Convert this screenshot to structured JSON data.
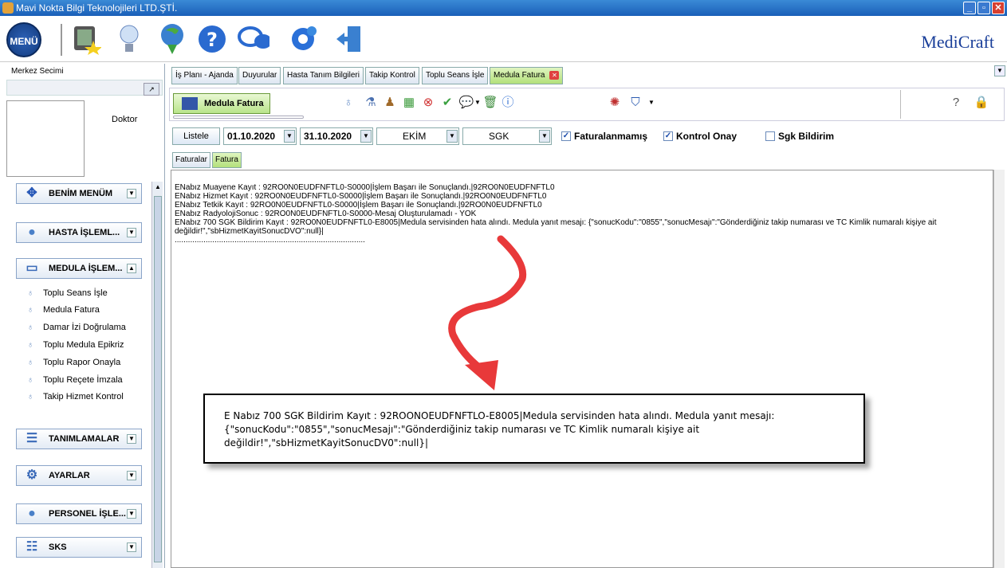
{
  "window": {
    "title": "Mavi Nokta Bilgi Teknolojileri LTD.ŞTİ.",
    "min": "_",
    "restore": "▫",
    "close": "✕"
  },
  "toolbar": {
    "menu_label": "MENÜ",
    "brand": "MediCraft",
    "icons": [
      "book-star-icon",
      "lightbulb-icon",
      "internet-download-icon",
      "help-icon",
      "chat-icon",
      "settings-gear-icon",
      "exit-door-icon"
    ]
  },
  "left": {
    "merkez_label": "Merkez Secimi",
    "doktor_label": "Doktor",
    "groups": [
      {
        "label": "BENİM MENÜM"
      },
      {
        "label": "HASTA İŞLEML..."
      },
      {
        "label": "MEDULA İŞLEM..."
      },
      {
        "label": "TANIMLAMALAR"
      },
      {
        "label": "AYARLAR"
      },
      {
        "label": "PERSONEL İŞLE..."
      },
      {
        "label": "SKS"
      }
    ],
    "medula_items": [
      "Toplu Seans İşle",
      "Medula Fatura",
      "Damar İzi Doğrulama",
      "Toplu Medula Epikriz",
      "Toplu Rapor Onayla",
      "Toplu Reçete İmzala",
      "Takip Hizmet Kontrol"
    ]
  },
  "tabs": [
    "İş Planı - Ajanda",
    "Duyurular",
    "Hasta Tanım Bilgileri",
    "Takip Kontrol",
    "Toplu Seans İşle",
    "Medula Fatura"
  ],
  "subtoolbar": {
    "medula_fatura_button": "Medula Fatura"
  },
  "filters": {
    "listele": "Listele",
    "date_start": "01.10.2020",
    "date_end": "31.10.2020",
    "month": "EKİM",
    "institution": "SGK",
    "faturalanmamis": "Faturalanmamış",
    "kontrol_onay": "Kontrol Onay",
    "sgk_bildirim": "Sgk Bildirim"
  },
  "inner_tabs": [
    "Faturalar",
    "Fatura Kayıt Log"
  ],
  "log": {
    "lines": [
      "ENabız Muayene Kayıt : 92RO0N0EUDFNFTL0-S0000|İşlem Başarı ile Sonuçlandı.|92RO0N0EUDFNFTL0",
      "ENabız Hizmet Kayıt : 92RO0N0EUDFNFTL0-S0000|İşlem Başarı ile Sonuçlandı.|92RO0N0EUDFNFTL0",
      "ENabız Tetkik Kayıt : 92RO0N0EUDFNFTL0-S0000|İşlem Başarı ile Sonuçlandı.|92RO0N0EUDFNFTL0",
      "ENabız RadyolojiSonuc : 92RO0N0EUDFNFTL0-S0000-Mesaj Oluşturulamadı - YOK",
      "ENabız 700 SGK Bildirim Kayıt : 92RO0N0EUDFNFTL0-E8005|Medula servisinden hata alındı. Medula yanıt mesajı: {\"sonucKodu\":\"0855\",\"sonucMesajı\":\"Gönderdiğiniz takip numarası ve TC Kimlik numaralı kişiye ait değildir!\",\"sbHizmetKayitSonucDVO\":null}|",
      "......................................................................................"
    ]
  },
  "callout": {
    "text": "E Nabız 700 SGK Bildirim Kayıt : 92ROONOEUDFNFTLO-E8005|Medula servisinden hata alındı. Medula yanıt mesajı: {\"sonucKodu\":\"0855\",\"sonucMesajı\":\"Gönderdiğiniz takip numarası ve TC Kimlik numaralı kişiye ait değildir!\",\"sbHizmetKayitSonucDV0\":null}|"
  },
  "colors": {
    "titlebar": "#1a5fb8",
    "active_tab": "#b3e07a",
    "brand": "#1a3f9a",
    "arrow": "#e8393a"
  }
}
